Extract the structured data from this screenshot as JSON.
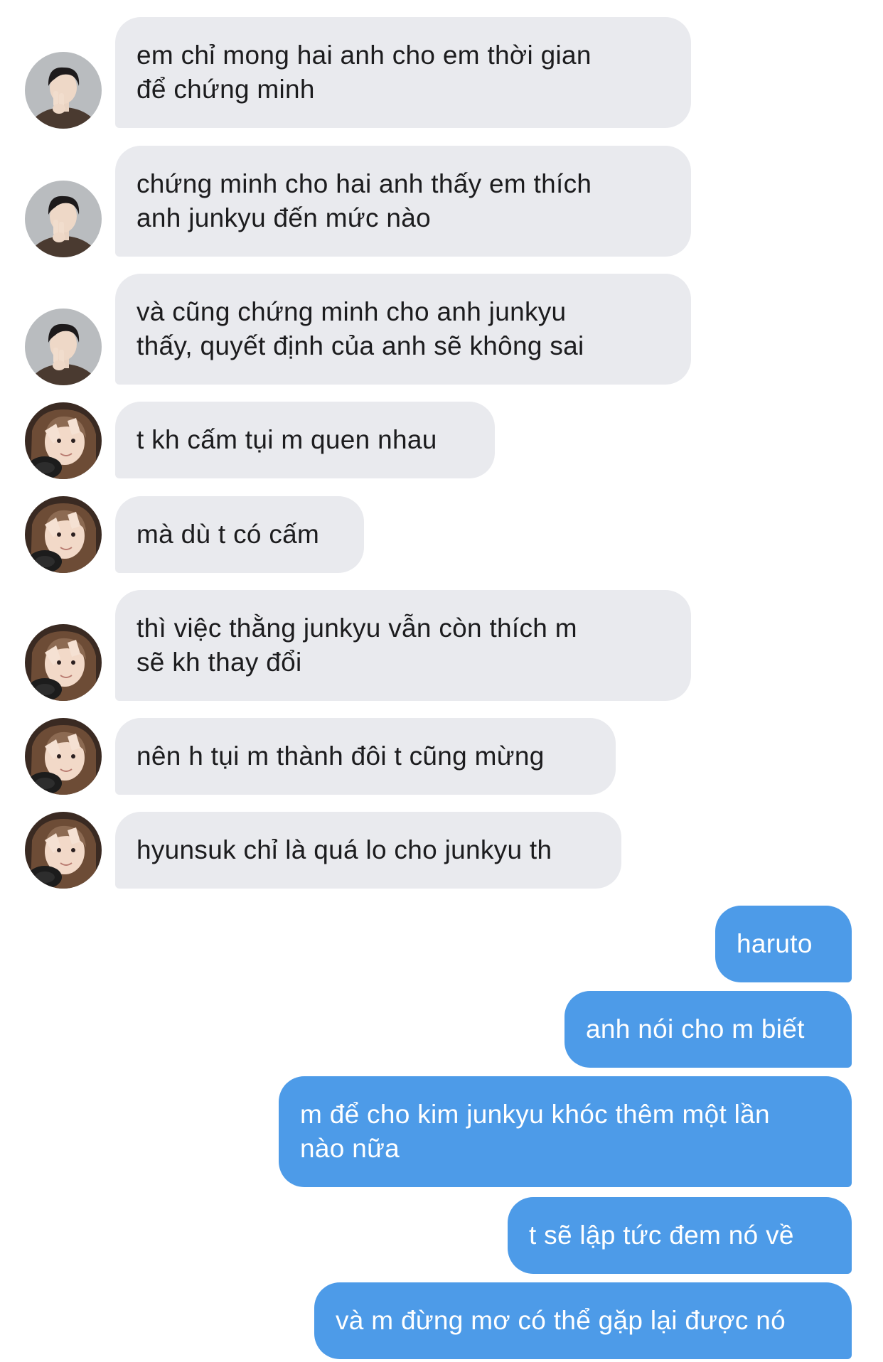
{
  "conversation": {
    "incoming": [
      {
        "sender": "a",
        "text": "em chỉ mong hai anh cho em thời gian\nđể chứng minh"
      },
      {
        "sender": "a",
        "text": "chứng minh cho hai anh thấy em thích\nanh junkyu đến mức nào"
      },
      {
        "sender": "a",
        "text": "và cũng chứng minh cho anh junkyu\nthấy, quyết định của anh sẽ không sai"
      },
      {
        "sender": "b",
        "text": "t kh cấm tụi m quen nhau"
      },
      {
        "sender": "b",
        "text": "mà dù t có cấm"
      },
      {
        "sender": "b",
        "text": "thì việc thằng junkyu vẫn còn thích m\nsẽ kh thay đổi"
      },
      {
        "sender": "b",
        "text": "nên h tụi m thành đôi t cũng mừng"
      },
      {
        "sender": "b",
        "text": "hyunsuk chỉ là quá lo cho junkyu th"
      }
    ],
    "outgoing": [
      {
        "text": "haruto"
      },
      {
        "text": "anh nói cho m biết"
      },
      {
        "text": "m để cho kim junkyu khóc thêm một lần\nnào nữa"
      },
      {
        "text": "t sẽ lập tức đem nó về"
      },
      {
        "text": "và m đừng mơ có thể gặp lại được nó"
      }
    ]
  },
  "colors": {
    "incoming_bubble": "#e9eaee",
    "outgoing_bubble": "#4d9be8",
    "incoming_text": "#1c1c1e",
    "outgoing_text": "#ffffff"
  },
  "avatars": {
    "a": "contact-a-avatar (portrait, dark hair, peace sign)",
    "b": "contact-b-avatar (portrait, hand over face, headphones)"
  }
}
